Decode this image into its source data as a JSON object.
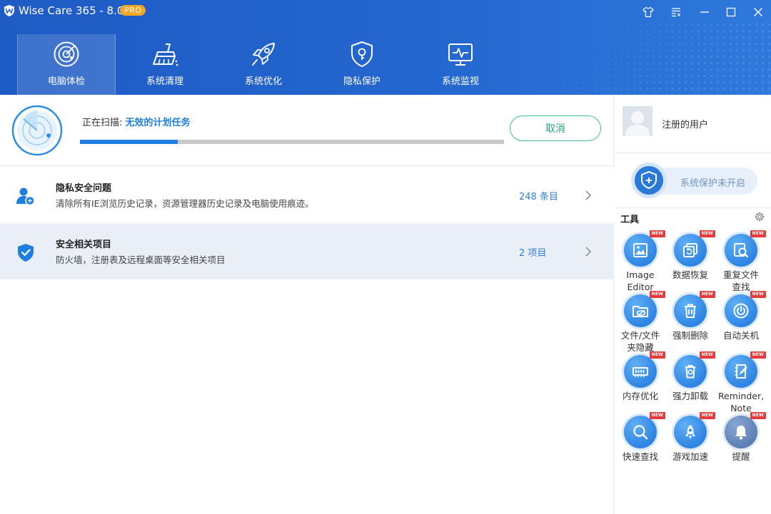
{
  "app": {
    "title": "Wise Care 365 - 8.0.6",
    "badge": "PRO"
  },
  "window_controls": [
    "skin-icon",
    "menu-icon",
    "minimize-icon",
    "maximize-icon",
    "close-icon"
  ],
  "nav": [
    {
      "label": "电脑体检",
      "icon": "radar-icon",
      "active": true
    },
    {
      "label": "系统清理",
      "icon": "broom-icon",
      "active": false
    },
    {
      "label": "系统优化",
      "icon": "rocket-icon",
      "active": false
    },
    {
      "label": "隐私保护",
      "icon": "shield-lock-icon",
      "active": false
    },
    {
      "label": "系统监视",
      "icon": "monitor-icon",
      "active": false
    }
  ],
  "scan": {
    "prefix": "正在扫描: ",
    "target": "无效的计划任务",
    "progress": 0.23,
    "cancel_label": "取消"
  },
  "results": [
    {
      "title": "隐私安全问题",
      "desc": "清除所有IE浏览历史记录，资源管理器历史记录及电脑使用痕迹。",
      "count": "248 条目",
      "icon": "privacy-user-icon"
    },
    {
      "title": "安全相关项目",
      "desc": "防火墙，注册表及远程桌面等安全相关项目",
      "count": "2 项目",
      "icon": "security-shield-icon"
    }
  ],
  "user": {
    "name": "注册的用户"
  },
  "protection": {
    "label": "系统保护未开启"
  },
  "tools": {
    "title": "工具",
    "new_label": "NEW",
    "items": [
      {
        "label": "Image\nEditor",
        "icon": "image-editor-icon"
      },
      {
        "label": "数据恢复",
        "icon": "data-recovery-icon"
      },
      {
        "label": "重复文件\n查找",
        "icon": "duplicate-finder-icon"
      },
      {
        "label": "文件/文件\n夹隐藏",
        "icon": "folder-hide-icon"
      },
      {
        "label": "强制删除",
        "icon": "force-delete-icon"
      },
      {
        "label": "自动关机",
        "icon": "auto-shutdown-icon"
      },
      {
        "label": "内存优化",
        "icon": "memory-optimize-icon"
      },
      {
        "label": "强力卸载",
        "icon": "force-uninstall-icon"
      },
      {
        "label": "Reminder,\nNote",
        "icon": "reminder-note-icon"
      },
      {
        "label": "快速查找",
        "icon": "quick-search-icon"
      },
      {
        "label": "游戏加速",
        "icon": "game-boost-icon"
      },
      {
        "label": "提醒",
        "icon": "bell-icon"
      }
    ]
  },
  "colors": {
    "header": "#2466cf",
    "accent": "#1e7fe0",
    "cancel": "#3cbf94",
    "new_badge": "#e43c3c",
    "pro_badge": "#f5a623"
  }
}
